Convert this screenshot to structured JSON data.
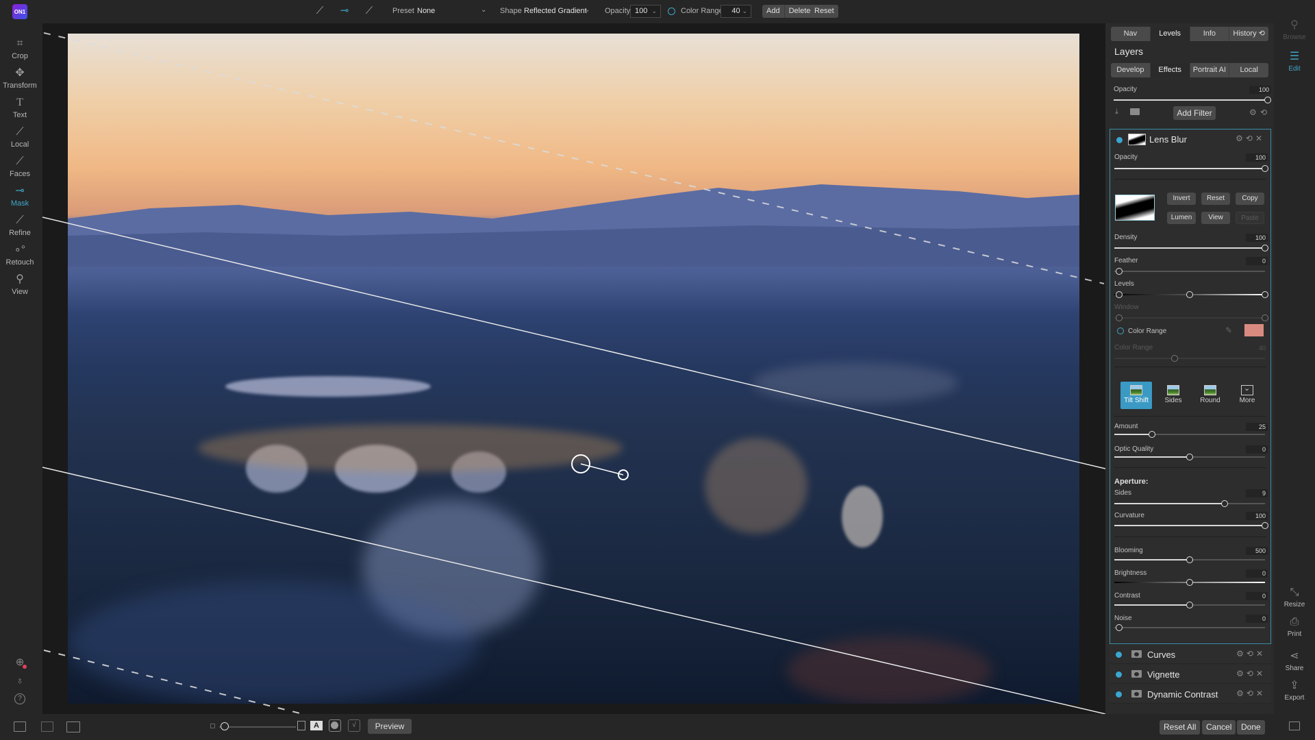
{
  "app": {
    "logo_text": "ON1"
  },
  "toolbar": {
    "mask_tool_icons": [
      "brush-mask-icon",
      "gradient-mask-icon",
      "ai-mask-icon"
    ],
    "preset_label": "Preset",
    "preset_value": "None",
    "shape_label": "Shape",
    "shape_value": "Reflected Gradient",
    "opacity_label": "Opacity",
    "opacity_value": "100",
    "color_range_label": "Color Range",
    "color_range_value": "40",
    "add_label": "Add",
    "delete_label": "Delete",
    "reset_label": "Reset"
  },
  "left_tools": [
    {
      "label": "Crop",
      "icon": "crop-icon",
      "glyph": "⌗"
    },
    {
      "label": "Transform",
      "icon": "transform-icon",
      "glyph": "✥"
    },
    {
      "label": "Text",
      "icon": "text-icon",
      "glyph": "T"
    },
    {
      "label": "Local",
      "icon": "local-brush-icon",
      "glyph": "⟋"
    },
    {
      "label": "Faces",
      "icon": "faces-icon",
      "glyph": "⟋"
    },
    {
      "label": "Mask",
      "icon": "mask-icon",
      "glyph": "⊸",
      "active": true
    },
    {
      "label": "Refine",
      "icon": "refine-icon",
      "glyph": "⟋"
    },
    {
      "label": "Retouch",
      "icon": "retouch-icon",
      "glyph": "∘°"
    },
    {
      "label": "View",
      "icon": "view-icon",
      "glyph": "⚲"
    }
  ],
  "left_bottom_icons": [
    "extras-icon",
    "account-icon",
    "help-icon"
  ],
  "bottom_bar": {
    "preview_label": "Preview",
    "reset_all_label": "Reset All",
    "cancel_label": "Cancel",
    "done_label": "Done"
  },
  "panel": {
    "top_tabs": [
      "Nav",
      "Levels",
      "Info",
      "History ⟲"
    ],
    "top_tab_selected": "Levels",
    "title": "Layers",
    "module_tabs": [
      "Develop",
      "Effects",
      "Portrait AI",
      "Local"
    ],
    "module_tab_selected": "Effects",
    "layer_opacity_label": "Opacity",
    "layer_opacity_value": "100",
    "add_filter_label": "Add Filter",
    "filter": {
      "name": "Lens Blur",
      "opacity_label": "Opacity",
      "opacity_value": "100",
      "mask_buttons": [
        "Invert",
        "Reset",
        "Copy",
        "Lumen",
        "View",
        "Paste"
      ],
      "density_label": "Density",
      "density_value": "100",
      "feather_label": "Feather",
      "feather_value": "0",
      "levels_label": "Levels",
      "window_label": "Window",
      "color_range_label": "Color Range",
      "color_range_swatch": "#d98a80",
      "color_range_slider_label": "Color Range",
      "color_range_slider_value": "40",
      "presets": [
        "Tilt Shift",
        "Sides",
        "Round",
        "More"
      ],
      "preset_selected": "Tilt Shift",
      "amount_label": "Amount",
      "amount_value": "25",
      "optic_label": "Optic Quality",
      "optic_value": "0",
      "aperture_label": "Aperture:",
      "sides_label": "Sides",
      "sides_value": "9",
      "curvature_label": "Curvature",
      "curvature_value": "100",
      "blooming_label": "Blooming",
      "blooming_value": "500",
      "brightness_label": "Brightness",
      "brightness_value": "0",
      "contrast_label": "Contrast",
      "contrast_value": "0",
      "noise_label": "Noise",
      "noise_value": "0"
    },
    "other_layers": [
      "Curves",
      "Vignette",
      "Dynamic Contrast"
    ]
  },
  "right_rail": [
    {
      "label": "Browse",
      "icon": "browse-icon"
    },
    {
      "label": "Edit",
      "icon": "edit-icon",
      "active": true
    },
    {
      "label": "Resize",
      "icon": "resize-icon"
    },
    {
      "label": "Print",
      "icon": "print-icon"
    },
    {
      "label": "Share",
      "icon": "share-icon"
    },
    {
      "label": "Export",
      "icon": "export-icon"
    }
  ],
  "colors": {
    "accent": "#3fa7c9",
    "panel_bg": "#2b2b2b",
    "selected_border": "#3a8fa8"
  }
}
